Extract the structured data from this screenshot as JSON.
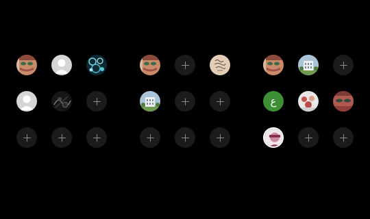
{
  "panels": [
    {
      "slots": [
        {
          "type": "photo",
          "icon": "face-portrait"
        },
        {
          "type": "default-avatar",
          "icon": "person-silhouette"
        },
        {
          "type": "photo",
          "icon": "teal-pattern"
        },
        {
          "type": "default-avatar",
          "icon": "person-silhouette"
        },
        {
          "type": "photo",
          "icon": "dark-scene"
        },
        {
          "type": "empty",
          "icon": "plus"
        },
        {
          "type": "empty",
          "icon": "plus"
        },
        {
          "type": "empty",
          "icon": "plus"
        },
        {
          "type": "empty",
          "icon": "plus"
        }
      ]
    },
    {
      "slots": [
        {
          "type": "photo",
          "icon": "face-portrait"
        },
        {
          "type": "empty",
          "icon": "plus"
        },
        {
          "type": "photo",
          "icon": "handwritten-note"
        },
        {
          "type": "photo",
          "icon": "building"
        },
        {
          "type": "empty",
          "icon": "plus"
        },
        {
          "type": "empty",
          "icon": "plus"
        },
        {
          "type": "empty",
          "icon": "plus"
        },
        {
          "type": "empty",
          "icon": "plus"
        },
        {
          "type": "empty",
          "icon": "plus"
        }
      ]
    },
    {
      "slots": [
        {
          "type": "photo",
          "icon": "face-portrait"
        },
        {
          "type": "photo",
          "icon": "building"
        },
        {
          "type": "empty",
          "icon": "plus"
        },
        {
          "type": "letter",
          "label": "ع",
          "color": "#3e8e35"
        },
        {
          "type": "photo",
          "icon": "group-photo"
        },
        {
          "type": "photo",
          "icon": "face-closeup"
        },
        {
          "type": "photo",
          "icon": "person-selected"
        },
        {
          "type": "empty",
          "icon": "plus"
        },
        {
          "type": "empty",
          "icon": "plus"
        }
      ]
    }
  ]
}
